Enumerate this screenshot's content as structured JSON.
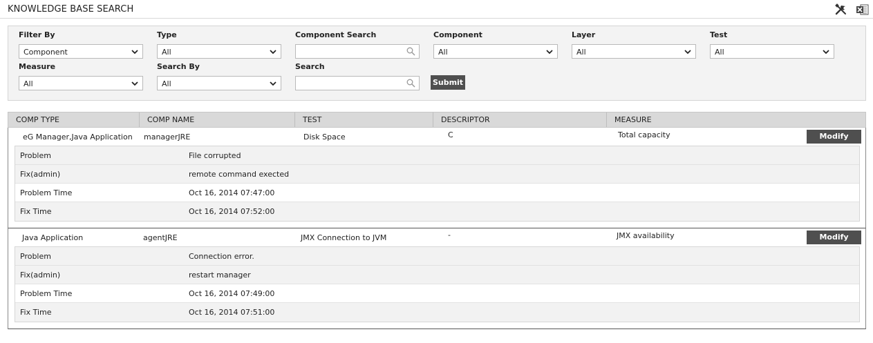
{
  "page": {
    "title": "KNOWLEDGE BASE SEARCH"
  },
  "toolbar": {
    "icons": [
      "tools-icon",
      "excel-export-icon"
    ]
  },
  "filters": {
    "filter_by": {
      "label": "Filter By",
      "value": "Component"
    },
    "type": {
      "label": "Type",
      "value": "All"
    },
    "component_search": {
      "label": "Component Search",
      "value": ""
    },
    "component": {
      "label": "Component",
      "value": "All"
    },
    "layer": {
      "label": "Layer",
      "value": "All"
    },
    "test": {
      "label": "Test",
      "value": "All"
    },
    "measure": {
      "label": "Measure",
      "value": "All"
    },
    "search_by": {
      "label": "Search By",
      "value": "All"
    },
    "search": {
      "label": "Search",
      "value": ""
    },
    "submit_label": "Submit"
  },
  "table": {
    "headers": [
      "COMP TYPE",
      "COMP NAME",
      "TEST",
      "DESCRIPTOR",
      "MEASURE"
    ],
    "modify_label": "Modify",
    "records": [
      {
        "comp_type": "eG Manager,Java Application",
        "comp_name": "managerJRE",
        "test": "Disk Space",
        "descriptor": "C",
        "measure": "Total capacity",
        "details": [
          {
            "label": "Problem",
            "value": "File corrupted"
          },
          {
            "label": "Fix(admin)",
            "value": "remote command exected"
          },
          {
            "label": "Problem Time",
            "value": "Oct 16, 2014 07:47:00"
          },
          {
            "label": "Fix Time",
            "value": "Oct 16, 2014 07:52:00"
          }
        ]
      },
      {
        "comp_type": "Java Application",
        "comp_name": "agentJRE",
        "test": "JMX Connection to JVM",
        "descriptor": "-",
        "measure": "JMX availability",
        "details": [
          {
            "label": "Problem",
            "value": "Connection error."
          },
          {
            "label": "Fix(admin)",
            "value": "restart manager"
          },
          {
            "label": "Problem Time",
            "value": "Oct 16, 2014 07:49:00"
          },
          {
            "label": "Fix Time",
            "value": "Oct 16, 2014 07:51:00"
          }
        ]
      }
    ]
  }
}
